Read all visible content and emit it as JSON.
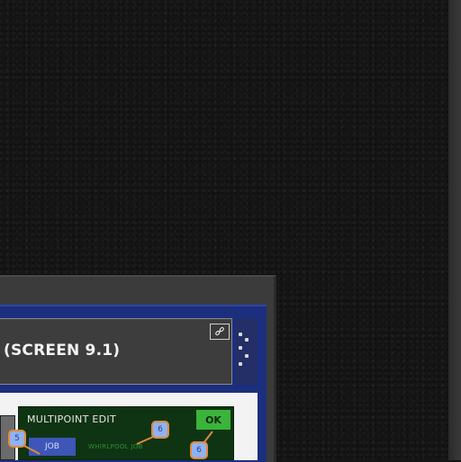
{
  "background": {
    "color": "#151515",
    "accent_strip": "#333333"
  },
  "dialog": {
    "title": "(SCREEN 9.1)",
    "link_icon": "link-icon",
    "panel_colors": {
      "frame": "#3b3b3b",
      "blue": "#1c2f7e",
      "green": "#0f3413",
      "ok": "#3bb43b"
    }
  },
  "preview": {
    "heading": "MULTIPOINT EDIT",
    "ok_label": "OK",
    "blue_button_label": "JOB",
    "sub_label": "WHIRLPOOL JOB",
    "markers": [
      "5",
      "6",
      "6"
    ]
  }
}
